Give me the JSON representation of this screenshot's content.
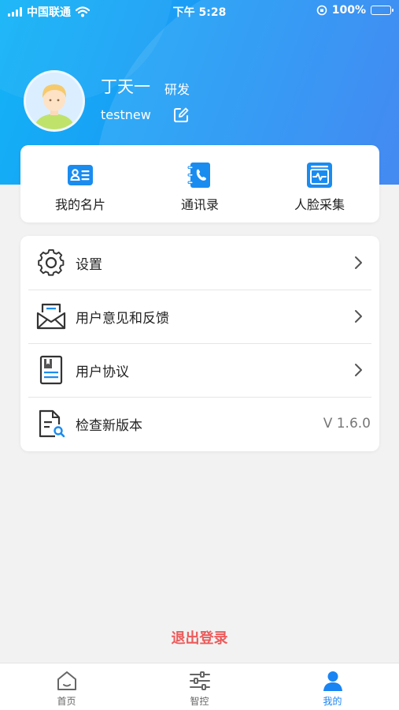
{
  "status_bar": {
    "carrier": "中国联通",
    "time": "下午 5:28",
    "battery": "100%",
    "icons": [
      "signal-icon",
      "wifi-icon",
      "orientation-lock-icon",
      "battery-icon"
    ]
  },
  "profile": {
    "name": "丁天一",
    "department": "研发",
    "account": "testnew"
  },
  "shortcuts": [
    {
      "label": "我的名片",
      "icon": "business-card-icon"
    },
    {
      "label": "通讯录",
      "icon": "contacts-icon"
    },
    {
      "label": "人脸采集",
      "icon": "face-capture-icon"
    }
  ],
  "menu": [
    {
      "label": "设置",
      "icon": "gear-icon"
    },
    {
      "label": "用户意见和反馈",
      "icon": "feedback-mail-icon"
    },
    {
      "label": "用户协议",
      "icon": "agreement-doc-icon"
    },
    {
      "label": "检查新版本",
      "icon": "version-search-icon",
      "value": "V 1.6.0"
    }
  ],
  "logout_label": "退出登录",
  "tabs": [
    {
      "label": "首页",
      "icon": "home-icon",
      "active": false
    },
    {
      "label": "智控",
      "icon": "sliders-icon",
      "active": false
    },
    {
      "label": "我的",
      "icon": "user-icon",
      "active": true
    }
  ],
  "colors": {
    "header_gradient_start": "#12b4f7",
    "header_gradient_end": "#2f7cf0",
    "accent": "#1a84f2",
    "logout": "#ec5b5b",
    "background": "#f2f2f2"
  }
}
